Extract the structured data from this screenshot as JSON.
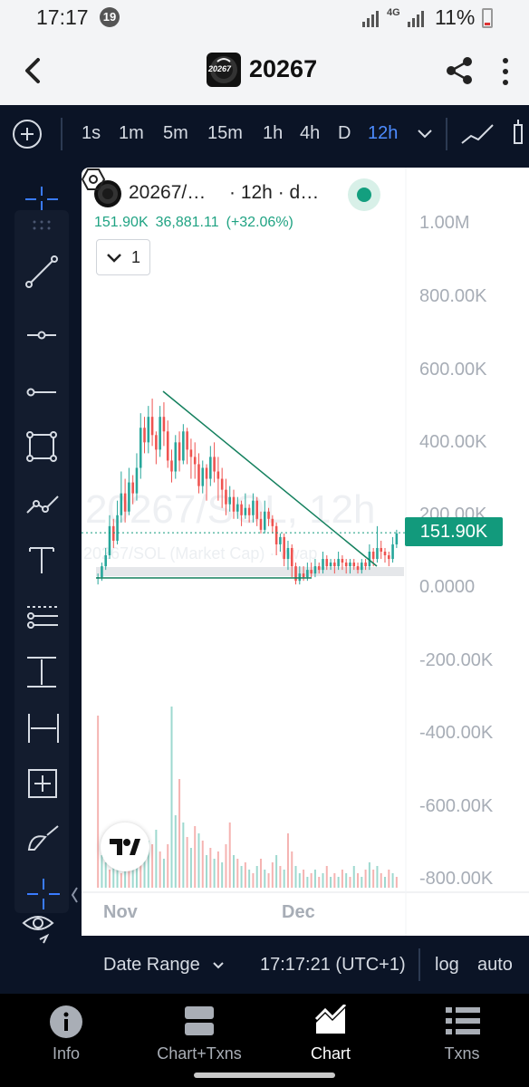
{
  "status_bar": {
    "time": "17:17",
    "notification_count": "19",
    "network": "4G",
    "battery": "11%"
  },
  "header": {
    "title": "20267",
    "logo_text": "20267"
  },
  "timeframes": [
    {
      "label": "1s",
      "active": false
    },
    {
      "label": "1m",
      "active": false
    },
    {
      "label": "5m",
      "active": false
    },
    {
      "label": "15m",
      "active": false
    },
    {
      "label": "1h",
      "active": false
    },
    {
      "label": "4h",
      "active": false
    },
    {
      "label": "D",
      "active": false
    },
    {
      "label": "12h",
      "active": true
    }
  ],
  "drawing_tools": [
    "trend-line-icon",
    "horizontal-ray-icon",
    "horizontal-line-icon",
    "rectangle-icon",
    "path-icon",
    "text-icon",
    "fib-icon",
    "price-range-icon",
    "date-range-icon",
    "date-price-range-icon",
    "brush-icon",
    "crosshair-icon",
    "eye-icon"
  ],
  "chart": {
    "legend_title": "20267/…",
    "legend_interval": "· 12h · d…",
    "legend_values": {
      "close": "151.90K",
      "change": "36,881.11",
      "change_pct": "(+32.06%)"
    },
    "collapse_count": "1",
    "price_tag": "151.90K",
    "watermark_main": "20267/SOL, 12h",
    "watermark_sub": "20267/SOL (Market Cap) · vwap",
    "colors": {
      "up": "#26a69a",
      "down": "#ef5350",
      "up_volume": "#9ed9cf",
      "down_volume": "#f5b3b1",
      "trendline": "#14805e",
      "price_tag": "#129a7c"
    }
  },
  "chart_data": {
    "type": "candlestick",
    "title": "20267/SOL, 12h",
    "series_name": "20267/SOL (Market Cap)",
    "y_axis_labels": [
      "1.00M",
      "800.00K",
      "600.00K",
      "400.00K",
      "200.00K",
      "0.0000",
      "-200.00K",
      "-400.00K",
      "-600.00K",
      "-800.00K"
    ],
    "ylim": [
      -800000,
      1000000
    ],
    "x_axis_labels": [
      "Nov",
      "Dec"
    ],
    "last_price": 151900,
    "candles": [
      [
        30,
        30,
        10,
        40
      ],
      [
        30,
        60,
        20,
        70
      ],
      [
        60,
        90,
        50,
        110
      ],
      [
        90,
        170,
        80,
        200
      ],
      [
        170,
        130,
        110,
        190
      ],
      [
        130,
        200,
        120,
        240
      ],
      [
        200,
        260,
        180,
        320
      ],
      [
        260,
        210,
        180,
        300
      ],
      [
        210,
        290,
        200,
        330
      ],
      [
        290,
        260,
        230,
        310
      ],
      [
        260,
        330,
        240,
        370
      ],
      [
        330,
        440,
        300,
        480
      ],
      [
        440,
        400,
        370,
        470
      ],
      [
        400,
        470,
        370,
        500
      ],
      [
        470,
        420,
        390,
        520
      ],
      [
        420,
        380,
        340,
        430
      ],
      [
        380,
        470,
        360,
        500
      ],
      [
        470,
        430,
        390,
        510
      ],
      [
        430,
        350,
        330,
        460
      ],
      [
        350,
        320,
        290,
        380
      ],
      [
        320,
        400,
        300,
        420
      ],
      [
        400,
        350,
        320,
        430
      ],
      [
        350,
        430,
        340,
        450
      ],
      [
        430,
        380,
        340,
        440
      ],
      [
        380,
        360,
        300,
        410
      ],
      [
        360,
        340,
        300,
        400
      ],
      [
        340,
        280,
        260,
        370
      ],
      [
        280,
        330,
        260,
        350
      ],
      [
        330,
        300,
        240,
        340
      ],
      [
        300,
        360,
        280,
        390
      ],
      [
        360,
        320,
        290,
        400
      ],
      [
        320,
        300,
        240,
        360
      ],
      [
        300,
        270,
        220,
        330
      ],
      [
        270,
        230,
        200,
        300
      ],
      [
        230,
        250,
        210,
        280
      ],
      [
        250,
        210,
        190,
        270
      ],
      [
        210,
        230,
        190,
        250
      ],
      [
        230,
        200,
        170,
        240
      ],
      [
        200,
        220,
        190,
        260
      ],
      [
        220,
        200,
        180,
        230
      ],
      [
        200,
        240,
        180,
        260
      ],
      [
        240,
        190,
        170,
        250
      ],
      [
        190,
        160,
        150,
        210
      ],
      [
        160,
        210,
        150,
        240
      ],
      [
        210,
        190,
        170,
        220
      ],
      [
        190,
        170,
        150,
        200
      ],
      [
        170,
        120,
        90,
        180
      ],
      [
        120,
        140,
        100,
        150
      ],
      [
        140,
        80,
        60,
        150
      ],
      [
        80,
        110,
        50,
        130
      ],
      [
        110,
        60,
        30,
        120
      ],
      [
        60,
        20,
        10,
        70
      ],
      [
        20,
        40,
        10,
        60
      ],
      [
        40,
        30,
        20,
        60
      ],
      [
        30,
        50,
        20,
        70
      ],
      [
        50,
        40,
        30,
        70
      ],
      [
        40,
        60,
        30,
        80
      ],
      [
        60,
        50,
        40,
        70
      ],
      [
        50,
        80,
        40,
        100
      ],
      [
        80,
        60,
        50,
        90
      ],
      [
        60,
        70,
        50,
        80
      ],
      [
        70,
        60,
        40,
        80
      ],
      [
        60,
        80,
        50,
        100
      ],
      [
        80,
        70,
        50,
        90
      ],
      [
        70,
        60,
        40,
        80
      ],
      [
        60,
        70,
        40,
        80
      ],
      [
        70,
        60,
        50,
        80
      ],
      [
        60,
        50,
        40,
        70
      ],
      [
        50,
        70,
        40,
        80
      ],
      [
        70,
        60,
        50,
        80
      ],
      [
        60,
        100,
        50,
        120
      ],
      [
        100,
        80,
        60,
        110
      ],
      [
        80,
        110,
        70,
        170
      ],
      [
        110,
        100,
        80,
        130
      ],
      [
        100,
        90,
        70,
        110
      ],
      [
        90,
        80,
        60,
        100
      ],
      [
        80,
        120,
        70,
        140
      ],
      [
        120,
        150,
        110,
        160
      ]
    ],
    "volume_max": 100,
    "volumes": [
      [
        95,
        0
      ],
      [
        18,
        1
      ],
      [
        14,
        1
      ],
      [
        10,
        0
      ],
      [
        22,
        1
      ],
      [
        12,
        1
      ],
      [
        8,
        0
      ],
      [
        14,
        1
      ],
      [
        30,
        0
      ],
      [
        16,
        1
      ],
      [
        28,
        1
      ],
      [
        20,
        0
      ],
      [
        18,
        1
      ],
      [
        26,
        1
      ],
      [
        24,
        0
      ],
      [
        32,
        1
      ],
      [
        20,
        0
      ],
      [
        16,
        1
      ],
      [
        24,
        0
      ],
      [
        100,
        1
      ],
      [
        40,
        1
      ],
      [
        60,
        0
      ],
      [
        36,
        1
      ],
      [
        28,
        0
      ],
      [
        22,
        1
      ],
      [
        34,
        0
      ],
      [
        30,
        1
      ],
      [
        26,
        0
      ],
      [
        18,
        1
      ],
      [
        22,
        0
      ],
      [
        16,
        1
      ],
      [
        20,
        0
      ],
      [
        14,
        1
      ],
      [
        24,
        0
      ],
      [
        36,
        0
      ],
      [
        18,
        1
      ],
      [
        16,
        0
      ],
      [
        12,
        1
      ],
      [
        14,
        0
      ],
      [
        10,
        1
      ],
      [
        8,
        0
      ],
      [
        12,
        1
      ],
      [
        16,
        0
      ],
      [
        10,
        1
      ],
      [
        8,
        0
      ],
      [
        14,
        0
      ],
      [
        18,
        1
      ],
      [
        12,
        0
      ],
      [
        10,
        1
      ],
      [
        30,
        0
      ],
      [
        20,
        0
      ],
      [
        12,
        1
      ],
      [
        8,
        1
      ],
      [
        10,
        0
      ],
      [
        6,
        1
      ],
      [
        8,
        0
      ],
      [
        10,
        1
      ],
      [
        6,
        0
      ],
      [
        8,
        1
      ],
      [
        12,
        0
      ],
      [
        6,
        1
      ],
      [
        8,
        0
      ],
      [
        6,
        1
      ],
      [
        10,
        0
      ],
      [
        8,
        1
      ],
      [
        6,
        0
      ],
      [
        12,
        1
      ],
      [
        8,
        0
      ],
      [
        6,
        1
      ],
      [
        10,
        0
      ],
      [
        14,
        1
      ],
      [
        10,
        0
      ],
      [
        12,
        1
      ],
      [
        8,
        0
      ],
      [
        6,
        1
      ],
      [
        10,
        0
      ],
      [
        8,
        1
      ],
      [
        6,
        0
      ]
    ]
  },
  "range_bar": {
    "date_range_label": "Date Range",
    "clock": "17:17:21 (UTC+1)",
    "log_label": "log",
    "auto_label": "auto"
  },
  "bottom_nav": [
    {
      "label": "Info",
      "icon": "info-icon",
      "active": false
    },
    {
      "label": "Chart+Txns",
      "icon": "chart-txns-icon",
      "active": false
    },
    {
      "label": "Chart",
      "icon": "chart-icon",
      "active": true
    },
    {
      "label": "Txns",
      "icon": "list-icon",
      "active": false
    }
  ]
}
